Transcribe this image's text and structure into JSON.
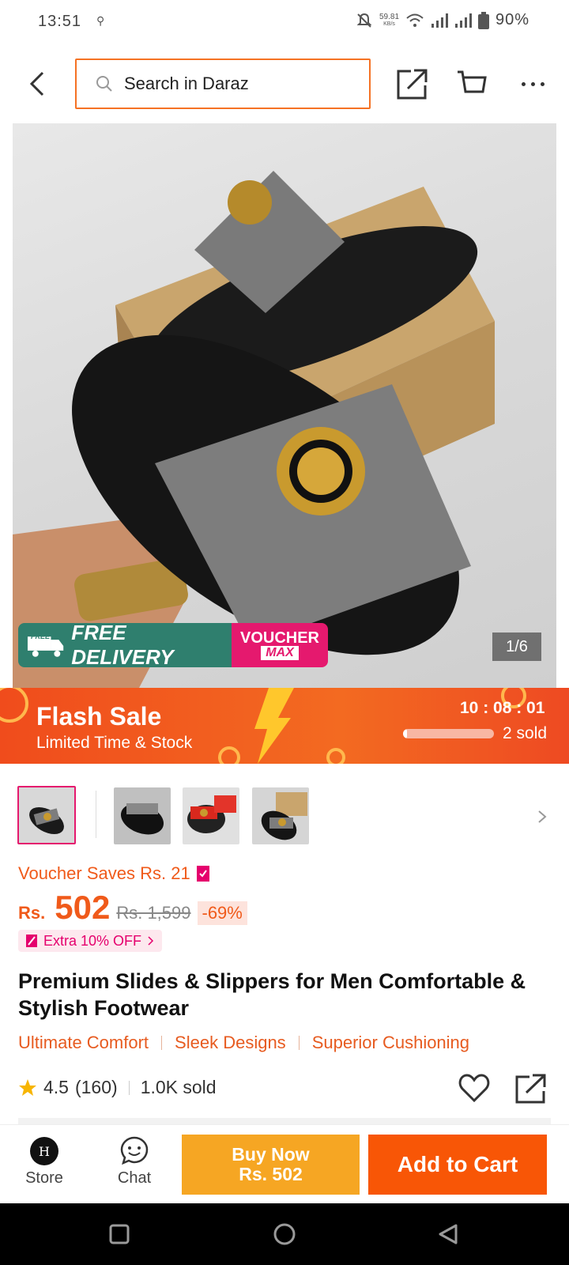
{
  "status_bar": {
    "time": "13:51",
    "net_speed": "59.81",
    "net_unit": "KB/s",
    "battery": "90%"
  },
  "header": {
    "search_placeholder": "Search in Daraz"
  },
  "hero": {
    "image_counter": "1/6",
    "free_delivery": "FREE DELIVERY",
    "free_small": "FREE",
    "voucher_top": "VOUCHER",
    "voucher_bottom": "MAX"
  },
  "flash_sale": {
    "title": "Flash Sale",
    "subtitle": "Limited Time & Stock",
    "countdown": "10 : 08 : 01",
    "sold": "2 sold",
    "progress": 0.04
  },
  "product": {
    "voucher_saves": "Voucher Saves Rs. 21",
    "currency": "Rs.",
    "price": "502",
    "original_price": "Rs. 1,599",
    "discount": "-69%",
    "extra_off": "Extra 10% OFF",
    "title": "Premium Slides & Slippers for Men Comfortable & Stylish Footwear",
    "tags": [
      "Ultimate Comfort",
      "Sleek Designs",
      "Superior Cushioning"
    ],
    "rating": "4.5",
    "reviews": "(160)",
    "sold": "1.0K sold"
  },
  "bottom_bar": {
    "store_label": "Store",
    "chat_label": "Chat",
    "buy_now_line1": "Buy Now",
    "buy_now_line2": "Rs. 502",
    "add_to_cart": "Add to Cart"
  },
  "colors": {
    "accent": "#f57224",
    "buy_now": "#f6a623",
    "add_to_cart": "#f85606",
    "discount_bg": "#fde3dc",
    "pink": "#e5006d"
  }
}
